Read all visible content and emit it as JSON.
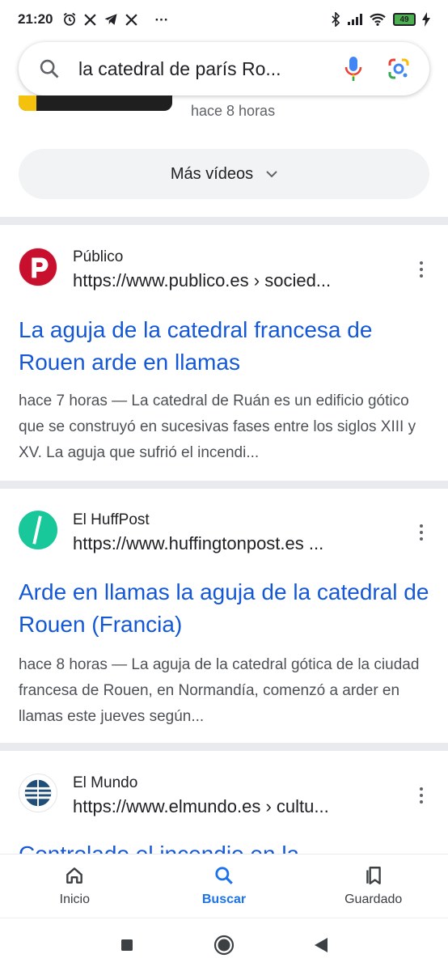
{
  "status": {
    "time": "21:20",
    "left_icons": [
      "alarm-icon",
      "x-icon",
      "telegram-icon",
      "x-icon"
    ],
    "more": "···",
    "battery": "49"
  },
  "search": {
    "query": "la catedral de parís Ro..."
  },
  "video": {
    "time": "hace 8 horas"
  },
  "more_videos": {
    "label": "Más vídeos"
  },
  "results": [
    {
      "site": "Público",
      "url": "https://www.publico.es › socied...",
      "title": "La aguja de la catedral francesa de Rouen arde en llamas",
      "snippet": "hace 7 horas — La catedral de Ruán es un edificio gótico que se construyó en sucesivas fases entre los siglos XIII y XV. La aguja que sufrió el incendi...",
      "favicon_color": "#c8102e"
    },
    {
      "site": "El HuffPost",
      "url": "https://www.huffingtonpost.es ...",
      "title": "Arde en llamas la aguja de la catedral de Rouen (Francia)",
      "snippet": "hace 8 horas — La aguja de la catedral gótica de la ciudad francesa de Rouen, en Normandía, comenzó a arder en llamas este jueves según...",
      "favicon_color": "#18c79a"
    },
    {
      "site": "El Mundo",
      "url": "https://www.elmundo.es › cultu...",
      "title": "Controlado el incendio en la",
      "favicon_color": "#1f4e79"
    }
  ],
  "bottom_nav": [
    {
      "label": "Inicio",
      "icon": "home-icon"
    },
    {
      "label": "Buscar",
      "icon": "search-icon"
    },
    {
      "label": "Guardado",
      "icon": "bookmarks-icon"
    }
  ],
  "colors": {
    "link": "#1558d6",
    "accent": "#1a73e8"
  }
}
